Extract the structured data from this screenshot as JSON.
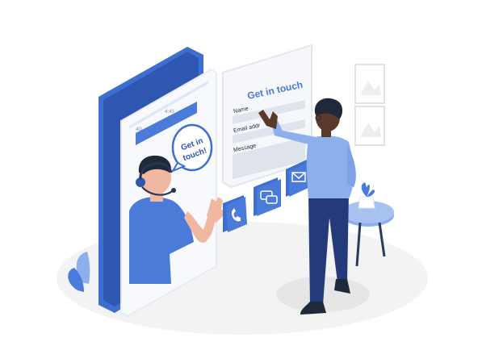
{
  "illustration": {
    "form_title": "Get in touch",
    "speech_bubble_line1": "Get in",
    "speech_bubble_line2": "touch!",
    "phone_time": "4:43",
    "phone_network": "4G",
    "form_fields": [
      "Name",
      "Email addr",
      "Message"
    ],
    "action_icons": [
      "phone-icon",
      "chat-icon",
      "mail-icon"
    ],
    "colors": {
      "primary_blue": "#4a7bd8",
      "dark_blue": "#2f56b0",
      "light_blue": "#8db0ec",
      "skin": "#f0b8a0",
      "dark_skin": "#5a3a2a",
      "pants": "#243a7a",
      "floor": "#f2f2f2"
    }
  }
}
